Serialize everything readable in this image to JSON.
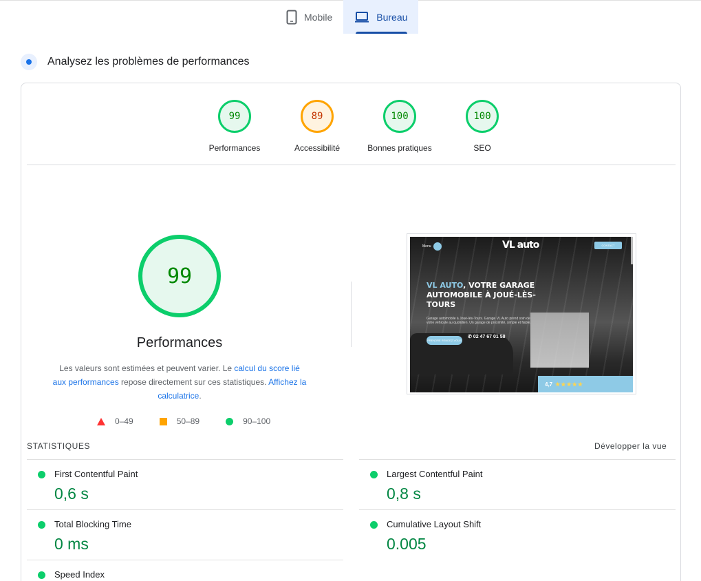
{
  "tabs": [
    {
      "label": "Mobile",
      "icon": "smartphone-icon",
      "active": false
    },
    {
      "label": "Bureau",
      "icon": "laptop-icon",
      "active": true
    }
  ],
  "section": {
    "title": "Analysez les problèmes de performances",
    "icon": "lighthouse-icon"
  },
  "gauges": [
    {
      "score": "99",
      "label": "Performances",
      "status": "pass"
    },
    {
      "score": "89",
      "label": "Accessibilité",
      "status": "average"
    },
    {
      "score": "100",
      "label": "Bonnes pratiques",
      "status": "pass"
    },
    {
      "score": "100",
      "label": "SEO",
      "status": "pass"
    }
  ],
  "main": {
    "score": "99",
    "label": "Performances",
    "desc_1": "Les valeurs sont estimées et peuvent varier. Le ",
    "link_1": "calcul du score lié aux performances",
    "desc_2": " repose directement sur ces statistiques. ",
    "link_2": "Affichez la calculatrice",
    "desc_3": "."
  },
  "legend": [
    {
      "range": "0–49",
      "color": "#ff3333"
    },
    {
      "range": "50–89",
      "color": "#ffa400"
    },
    {
      "range": "90–100",
      "color": "#0cce6b"
    }
  ],
  "screenshot": {
    "menu": "Menu",
    "logo": "VL auto",
    "contact": "CONTACT",
    "heading_accent": "VL AUTO",
    "heading_rest": ", VOTRE GARAGE AUTOMOBILE À JOUÉ-LÈS-TOURS",
    "paragraph": "Garage automobile à Joué-lès-Tours. Garage VL Auto prend soin de votre véhicule au quotidien. Un garage de proximité, simple et fiable.",
    "button": "PRENDRE RENDEZ-VOUS",
    "phone": "02 47 67 01 58",
    "rating": "4,7",
    "stars": "★★★★★"
  },
  "stats": {
    "heading": "STATISTIQUES",
    "expand": "Développer la vue",
    "metrics": [
      {
        "label": "First Contentful Paint",
        "value": "0,6 s"
      },
      {
        "label": "Largest Contentful Paint",
        "value": "0,8 s"
      },
      {
        "label": "Total Blocking Time",
        "value": "0 ms"
      },
      {
        "label": "Cumulative Layout Shift",
        "value": "0.005"
      },
      {
        "label": "Speed Index",
        "value": ""
      }
    ]
  }
}
